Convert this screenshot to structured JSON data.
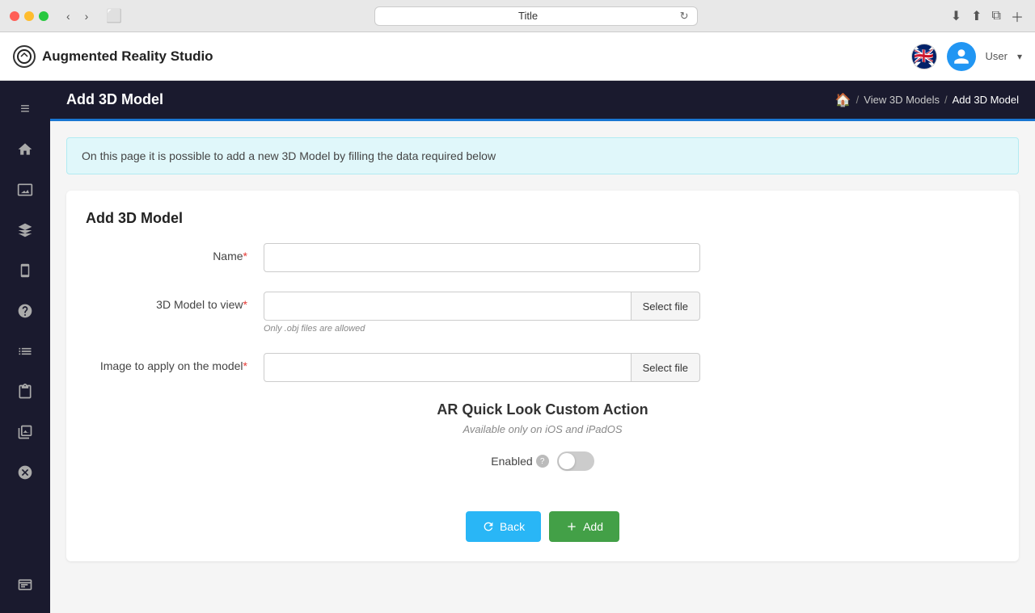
{
  "macos": {
    "tab_title": "Title"
  },
  "app": {
    "title": "Augmented Reality Studio",
    "user_label": "User"
  },
  "topbar": {
    "page_title": "Add 3D Model",
    "breadcrumb": {
      "home_icon": "🏠",
      "sep1": "/",
      "link_label": "View 3D Models",
      "sep2": "/",
      "current": "Add 3D Model"
    }
  },
  "info_banner": {
    "text": "On this page it is possible to add a new 3D Model by filling the data required below"
  },
  "form": {
    "card_title": "Add 3D Model",
    "name_label": "Name",
    "name_placeholder": "",
    "model_label": "3D Model to view",
    "model_hint": "Only .obj files are allowed",
    "select_file_1": "Select file",
    "image_label": "Image to apply on the model",
    "select_file_2": "Select file",
    "ar_section_title": "AR Quick Look Custom Action",
    "ar_section_subtitle": "Available only on iOS and iPadOS",
    "enabled_label": "Enabled",
    "back_label": "Back",
    "add_label": "Add"
  },
  "sidebar": {
    "items": [
      {
        "icon": "≡",
        "name": "menu"
      },
      {
        "icon": "⌂",
        "name": "home"
      },
      {
        "icon": "🖼",
        "name": "gallery"
      },
      {
        "icon": "◉",
        "name": "ar"
      },
      {
        "icon": "📱",
        "name": "mobile"
      },
      {
        "icon": "?",
        "name": "help"
      },
      {
        "icon": "☰",
        "name": "list"
      },
      {
        "icon": "📋",
        "name": "clipboard"
      },
      {
        "icon": "🖼",
        "name": "image-list"
      },
      {
        "icon": "⊗",
        "name": "close"
      }
    ],
    "terminal_icon": ">_"
  }
}
